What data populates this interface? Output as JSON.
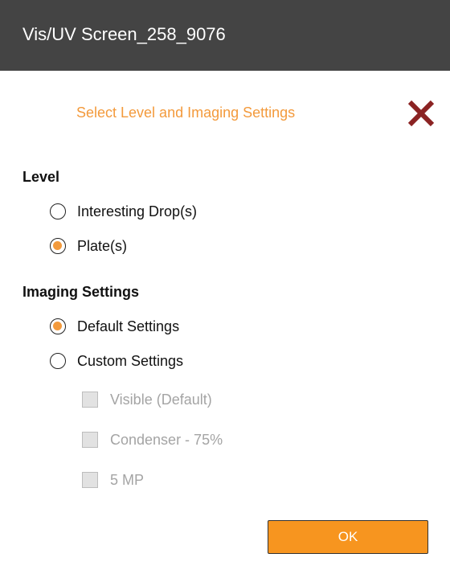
{
  "window": {
    "title": "Vis/UV Screen_258_9076"
  },
  "dialog": {
    "heading": "Select Level and Imaging Settings",
    "close_icon": "close-icon",
    "accent_color": "#f39a3c",
    "close_color": "#8b2323"
  },
  "level": {
    "label": "Level",
    "options": [
      {
        "label": "Interesting Drop(s)",
        "selected": false
      },
      {
        "label": "Plate(s)",
        "selected": true
      }
    ]
  },
  "imaging": {
    "label": "Imaging Settings",
    "options": [
      {
        "label": "Default Settings",
        "selected": true
      },
      {
        "label": "Custom Settings",
        "selected": false
      }
    ],
    "custom_options": [
      {
        "label": "Visible (Default)",
        "checked": false,
        "enabled": false
      },
      {
        "label": "Condenser - 75%",
        "checked": false,
        "enabled": false
      },
      {
        "label": "5 MP",
        "checked": false,
        "enabled": false
      }
    ]
  },
  "ok_button": {
    "label": "OK",
    "color": "#f7951f"
  }
}
